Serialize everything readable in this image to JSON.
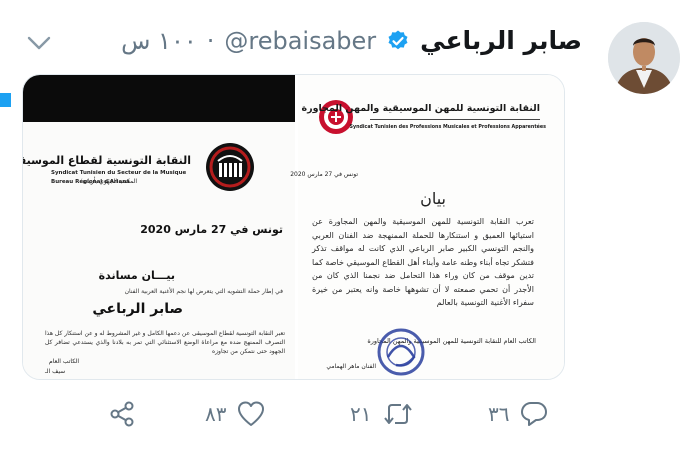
{
  "tweet": {
    "display_name": "صابر الرباعي",
    "handle": "@rebaisaber",
    "time": "١٠٠ س",
    "verified": true
  },
  "left_document": {
    "org_name_ar": "النقابة التونسية لقطاع الموسيقى",
    "org_name_fr": "Syndicat Tunisien du Secteur de la Musique",
    "bureau_fr": "Bureau Régional d'Ariana",
    "bureau_ar": "المكتب الجهوي بأريانة",
    "date": "تونس في 27 مارس 2020",
    "heading": "بيـــان مساندة",
    "name": "صابر الرباعي",
    "intro": "في إطار حملة التشويه التي يتعرض لها نجم الأغنية العربية الفنان",
    "paragraph": "تعبر النقابة التونسية لقطاع الموسيقى عن دعمها الكامل و غير المشروط له و عن استنكار كل هذا التصرف الممنهج ضده مع مراعاة الوضع الاستثنائي التي تمر به بلادنا والذي يستدعي تضافر كل الجهود حتى نتمكن من تجاوزه",
    "signature_label": "الكاتب العام",
    "signature_name": "سيف الـ"
  },
  "right_document": {
    "org_name_ar": "النقابة التونسية للمهن الموسيقية والمهن المجاورة",
    "org_name_fr": "Syndicat Tunisien des Professions Musicales et Professions Apparentées",
    "date": "تونس في 27 مارس 2020",
    "heading": "بيان",
    "paragraph": "تعرب النقابة التونسية للمهن الموسيقية والمهن المجاورة عن استيائها العميق و استنكارها للحملة الممنهجة ضد الفنان العربي والنجم التونسي الكبير صابر الرباعي الذي كانت له مواقف تذكر فتشكر تجاه أبناء وطنه عامة وأبناء أهل القطاع الموسيقي خاصة كما تدين موقف من كان وراء هذا التحامل ضد نجمنا الذي كان من الأجدر أن تحمي صمعته لا أن تشوهها خاصة وانه يعتبر من خيرة سفراء الأغنية التونسية بالعالم",
    "signature_label": "الكاتب العام للنقابة التونسية للمهن الموسيقية والمهن المجاورة",
    "signature_name": "الفنان ماهر الهمامي"
  },
  "actions": {
    "replies": "٣٦",
    "retweets": "٢١",
    "likes": "٨٣"
  },
  "colors": {
    "accent": "#1da1f2",
    "muted": "#657786",
    "seal_red": "#c8102e"
  },
  "icons": [
    "verified-badge-icon",
    "chevron-down-icon",
    "reply-icon",
    "retweet-icon",
    "like-icon",
    "share-icon"
  ]
}
